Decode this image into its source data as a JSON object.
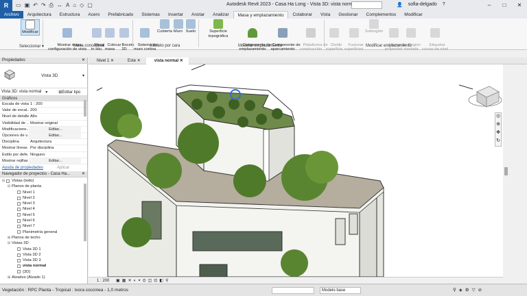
{
  "titlebar": {
    "app_title": "Autodesk Revit 2023 - Casa Ha Long - Vista 3D: vista normal",
    "user": "sofia-delgado",
    "search_placeholder": ""
  },
  "ribbon": {
    "tabs": [
      "Archivo",
      "Arquitectura",
      "Estructura",
      "Acero",
      "Prefabricado",
      "Sistemas",
      "Insertar",
      "Anotar",
      "Analizar",
      "Masa y emplazamiento",
      "Colaborar",
      "Vista",
      "Gestionar",
      "Complementos",
      "Modificar"
    ],
    "active_tab": "Masa y emplazamiento",
    "buttons": {
      "modificar": "Modificar",
      "mostrar_masa": "Mostrar masa\nconfiguración de vista",
      "masa_in_situ": "Masa\nin situ",
      "colocar_masa": "Colocar\nmasa",
      "boceto_3d": "Boceto\n3D",
      "sistema_muro_cortina": "Sistema de\nmuro cortina",
      "cubierta": "Cubierta",
      "muro": "Muro",
      "suelo": "Suelo",
      "superficie_topografica": "Superficie topográfica",
      "componente_emplazamiento": "Componente de\nemplazamiento",
      "componente_aparcamiento": "Componente de\naparcamiento",
      "plataforma_construccion": "Plataforma de\nconstrucción",
      "dividir_superficie": "Dividir\nsuperficie",
      "fusionar_superficies": "Fusionar\nsuperficies",
      "subregion": "Subregión",
      "lineas_propiedad": "Líneas de\npropiedad",
      "region_nivelada": "Región\nnivelada",
      "etiquetar_curvas": "Etiquetar\ncurvas de nivel"
    },
    "panels": {
      "seleccionar": "Seleccionar ▾",
      "masa_conceptual": "Masa conceptual",
      "modelo_por_cara": "Modelo por cara",
      "modelar_emplazamiento": "Modelar emplazamiento",
      "modificar_emplazamiento": "Modificar emplazamiento"
    }
  },
  "properties": {
    "title": "Propiedades",
    "type_name": "Vista 3D",
    "instance_label": "Vista 3D: vista normal",
    "edit_type": "Editar tipo",
    "category": "Gráficos",
    "rows": [
      {
        "k": "Escala de vista",
        "v": "1 : 200"
      },
      {
        "k": "Valor de escal...",
        "v": "200"
      },
      {
        "k": "Nivel de detalle",
        "v": "Alto"
      },
      {
        "k": "Visibilidad de ...",
        "v": "Mostrar original"
      },
      {
        "k": "Modificacione...",
        "v": "Editar..."
      },
      {
        "k": "Opciones de v...",
        "v": "Editar..."
      },
      {
        "k": "Disciplina",
        "v": "Arquitectura"
      },
      {
        "k": "Mostrar líneas ...",
        "v": "Por disciplina"
      },
      {
        "k": "Estilo por defe...",
        "v": "Ninguno"
      },
      {
        "k": "Mostrar rejillas",
        "v": "Editar..."
      }
    ],
    "help_link": "Ayuda de propiedades",
    "apply": "Aplicar"
  },
  "browser": {
    "title": "Navegador de proyectos - Casa Ha...",
    "nodes": [
      {
        "depth": 0,
        "toggle": "⊟",
        "label": "Vistas (todo)",
        "box": true
      },
      {
        "depth": 1,
        "toggle": "⊟",
        "label": "Planos de planta"
      },
      {
        "depth": 2,
        "label": "Nivel 1",
        "box": true
      },
      {
        "depth": 2,
        "label": "Nivel 2",
        "box": true
      },
      {
        "depth": 2,
        "label": "Nivel 3",
        "box": true
      },
      {
        "depth": 2,
        "label": "Nivel 4",
        "box": true
      },
      {
        "depth": 2,
        "label": "Nivel 5",
        "box": true
      },
      {
        "depth": 2,
        "label": "Nivel 6",
        "box": true
      },
      {
        "depth": 2,
        "label": "Nivel 7",
        "box": true
      },
      {
        "depth": 2,
        "label": "Planimetría general",
        "box": true
      },
      {
        "depth": 1,
        "toggle": "⊞",
        "label": "Planos de techo"
      },
      {
        "depth": 1,
        "toggle": "⊟",
        "label": "Vistas 3D"
      },
      {
        "depth": 2,
        "label": "Vista 3D 1",
        "box": true
      },
      {
        "depth": 2,
        "label": "Vista 3D 2",
        "box": true
      },
      {
        "depth": 2,
        "label": "Vista 3D 3",
        "box": true
      },
      {
        "depth": 2,
        "label": "vista normal",
        "box": true,
        "bold": true
      },
      {
        "depth": 2,
        "label": "{3D}",
        "box": true
      },
      {
        "depth": 1,
        "toggle": "⊞",
        "label": "Alzados (Alzado 1)"
      }
    ]
  },
  "view_tabs": [
    {
      "label": "Nivel 1",
      "active": false
    },
    {
      "label": "Este",
      "active": false
    },
    {
      "label": "vista normal",
      "active": true
    }
  ],
  "view_control": {
    "scale": "1 : 200"
  },
  "status": {
    "message": "Vegetación : RPC Planta - Tropical : Ixora coccinea - 1,0 metros",
    "model": "Modelo base"
  },
  "colors": {
    "brand": "#1f5fa8",
    "tree_green": "#4f7a2a",
    "building_white": "#f2f2ee",
    "selected_blue": "#2f6fd0"
  }
}
